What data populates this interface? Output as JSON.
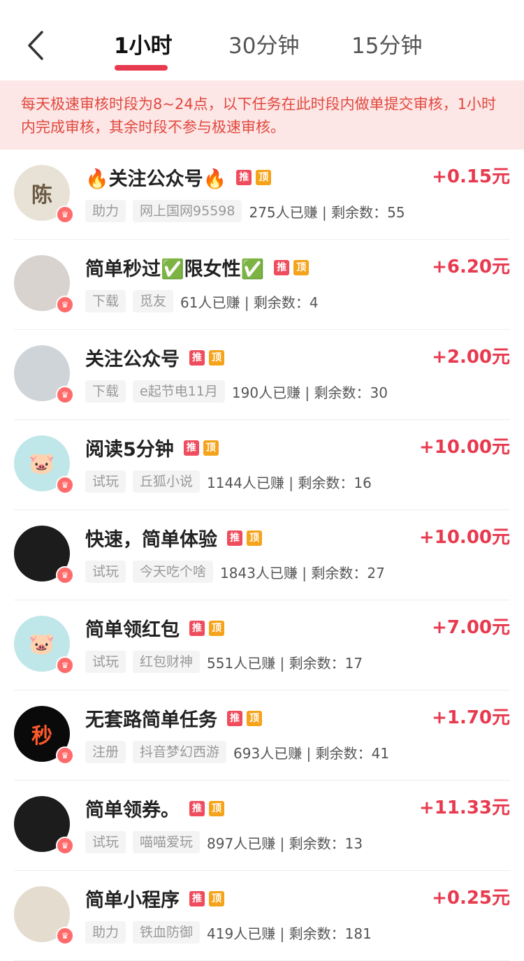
{
  "header": {
    "back_icon": "chevron-left-icon",
    "tabs": [
      {
        "label": "1小时",
        "active": true
      },
      {
        "label": "30分钟",
        "active": false
      },
      {
        "label": "15分钟",
        "active": false
      }
    ]
  },
  "notice": "每天极速审核时段为8~24点，以下任务在此时段内做单提交审核，1小时内完成审核，其余时段不参与极速审核。",
  "badges": {
    "tui": "推",
    "ding": "顶"
  },
  "colors": {
    "accent": "#e83a4f",
    "notice_bg": "#fde6e6",
    "notice_text": "#e0483e",
    "badge_tui": "#ef4c5d",
    "badge_ding": "#f5a31a"
  },
  "tasks": [
    {
      "title": "🔥关注公众号🔥",
      "reward": "+0.15元",
      "type": "助力",
      "app": "网上国网95598",
      "stats": "275人已赚 | 剩余数：55"
    },
    {
      "title": "简单秒过✅限女性✅",
      "reward": "+6.20元",
      "type": "下载",
      "app": "觅友",
      "stats": "61人已赚 | 剩余数：4"
    },
    {
      "title": "关注公众号",
      "reward": "+2.00元",
      "type": "下载",
      "app": "e起节电11月",
      "stats": "190人已赚 | 剩余数：30"
    },
    {
      "title": "阅读5分钟",
      "reward": "+10.00元",
      "type": "试玩",
      "app": "丘狐小说",
      "stats": "1144人已赚 | 剩余数：16"
    },
    {
      "title": "快速，简单体验",
      "reward": "+10.00元",
      "type": "试玩",
      "app": "今天吃个啥",
      "stats": "1843人已赚 | 剩余数：27"
    },
    {
      "title": "简单领红包",
      "reward": "+7.00元",
      "type": "试玩",
      "app": "红包财神",
      "stats": "551人已赚 | 剩余数：17"
    },
    {
      "title": "无套路简单任务",
      "reward": "+1.70元",
      "type": "注册",
      "app": "抖音梦幻西游",
      "stats": "693人已赚 | 剩余数：41"
    },
    {
      "title": "简单领券。",
      "reward": "+11.33元",
      "type": "试玩",
      "app": "喵喵爱玩",
      "stats": "897人已赚 | 剩余数：13"
    },
    {
      "title": "简单小程序",
      "reward": "+0.25元",
      "type": "助力",
      "app": "铁血防御",
      "stats": "419人已赚 | 剩余数：181"
    }
  ]
}
